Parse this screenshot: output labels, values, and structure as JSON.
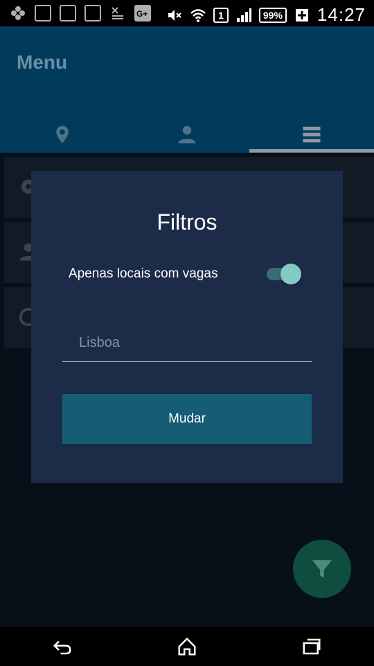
{
  "status_bar": {
    "time": "14:27",
    "battery": "99%",
    "sim": "1",
    "notification_icons": [
      "app-icon",
      "image-icon",
      "info-icon",
      "message-icon",
      "missed-call-icon",
      "google-plus-icon"
    ],
    "system_icons": [
      "mute-icon",
      "wifi-icon",
      "sim-icon",
      "signal-icon",
      "battery-icon",
      "charging-icon"
    ]
  },
  "app_bar": {
    "title": "Menu",
    "tabs": [
      {
        "icon": "location-pin-icon"
      },
      {
        "icon": "person-icon"
      },
      {
        "icon": "hamburger-menu-icon",
        "selected": true
      }
    ]
  },
  "menu_items": [
    {
      "icon": "gear-icon"
    },
    {
      "icon": "person-icon"
    },
    {
      "icon": "power-icon"
    }
  ],
  "dialog": {
    "title": "Filtros",
    "toggle_label": "Apenas locais com vagas",
    "toggle_on": true,
    "input_placeholder": "Lisboa",
    "input_value": "",
    "button_label": "Mudar"
  },
  "fab": {
    "icon": "filter-funnel-icon"
  },
  "nav_bar": [
    "back-icon",
    "home-icon",
    "recent-apps-icon"
  ],
  "colors": {
    "app_bar": "#003b5c",
    "dialog_bg": "#1c2b48",
    "button": "#155c74",
    "switch_thumb": "#80cbc4",
    "fab": "#0f4d3f"
  }
}
